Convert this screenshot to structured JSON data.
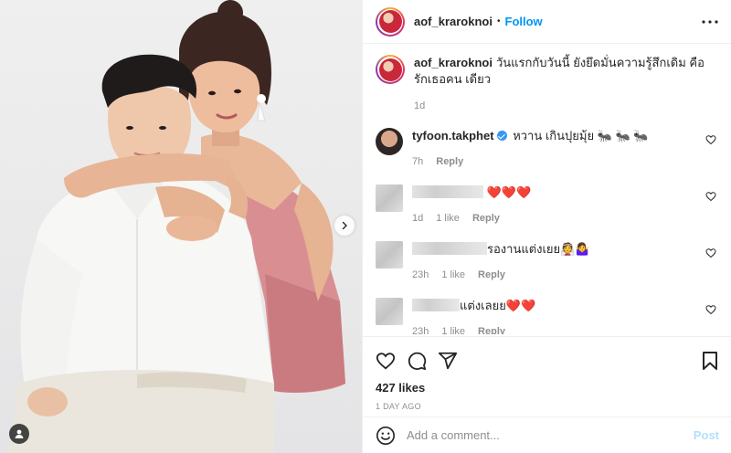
{
  "post": {
    "author": "aof_kraroknoi",
    "dot": "•",
    "follow_label": "Follow",
    "caption_text": "วันแรกกับวันนี้ ยังยึดมั่นความรู้สึกเดิม คือรักเธอคน เดียว",
    "caption_time": "1d"
  },
  "comments": [
    {
      "username": "tyfoon.takphet",
      "verified": true,
      "text": "หวาน เกินปุยมุ้ย 🐜 🐜 🐜",
      "time": "7h",
      "likes": "",
      "reply_label": "Reply"
    },
    {
      "username": "",
      "verified": false,
      "text": "❤️❤️❤️",
      "time": "1d",
      "likes": "1 like",
      "reply_label": "Reply"
    },
    {
      "username": "",
      "verified": false,
      "text": "รองานแต่งเยย👰🤷‍♀️",
      "time": "23h",
      "likes": "1 like",
      "reply_label": "Reply"
    },
    {
      "username": "",
      "verified": false,
      "text": "แต่งเลยย❤️❤️",
      "time": "23h",
      "likes": "1 like",
      "reply_label": "Reply"
    }
  ],
  "footer": {
    "likes_text": "427 likes",
    "date_text": "1 DAY AGO",
    "comment_placeholder": "Add a comment...",
    "post_label": "Post"
  },
  "icons": {
    "more": "more-horizontal-icon",
    "like": "heart-icon",
    "comment": "comment-icon",
    "share": "paper-plane-icon",
    "save": "bookmark-icon",
    "emoji": "emoji-icon",
    "next": "chevron-right-icon",
    "tags": "user-tag-icon"
  },
  "colors": {
    "accent": "#0095f6",
    "post_disabled": "#b2dffc",
    "muted": "#8e8e8e",
    "text": "#262626"
  }
}
